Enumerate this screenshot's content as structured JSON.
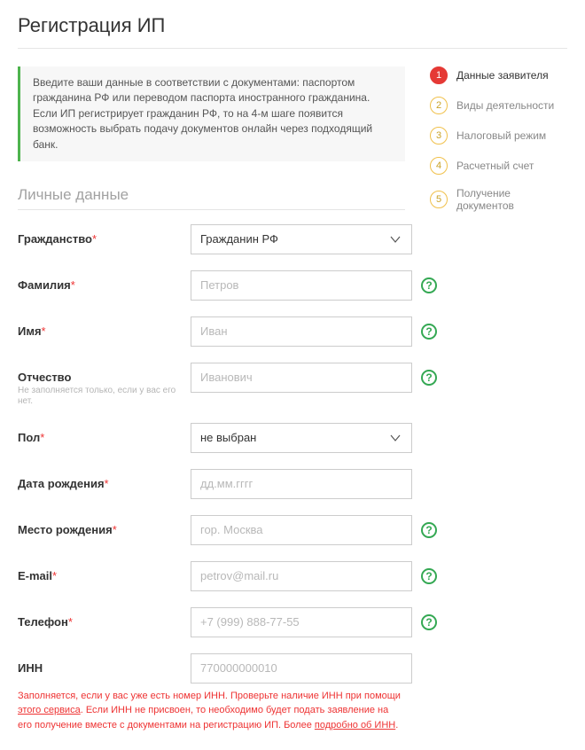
{
  "page_title": "Регистрация ИП",
  "info_notice": "Введите ваши данные в соответствии с документами: паспортом гражданина РФ или переводом паспорта иностранного гражданина.\nЕсли ИП регистрирует гражданин РФ, то на 4-м шаге появится возможность выбрать подачу документов онлайн через подходящий банк.",
  "section_title": "Личные данные",
  "fields": {
    "citizenship": {
      "label": "Гражданство",
      "required": true,
      "value": "Гражданин РФ"
    },
    "lastname": {
      "label": "Фамилия",
      "required": true,
      "placeholder": "Петров"
    },
    "firstname": {
      "label": "Имя",
      "required": true,
      "placeholder": "Иван"
    },
    "patronymic": {
      "label": "Отчество",
      "required": false,
      "placeholder": "Иванович",
      "hint": "Не заполняется только, если у вас его нет."
    },
    "gender": {
      "label": "Пол",
      "required": true,
      "value": "не выбран"
    },
    "birthdate": {
      "label": "Дата рождения",
      "required": true,
      "placeholder": "дд.мм.гггг"
    },
    "birthplace": {
      "label": "Место рождения",
      "required": true,
      "placeholder": "гор. Москва"
    },
    "email": {
      "label": "E-mail",
      "required": true,
      "placeholder": "petrov@mail.ru"
    },
    "phone": {
      "label": "Телефон",
      "required": true,
      "placeholder": "+7 (999) 888-77-55"
    },
    "inn": {
      "label": "ИНН",
      "required": false,
      "placeholder": "770000000010"
    }
  },
  "inn_note": {
    "part1": "Заполняется, если у вас уже есть номер ИНН. Проверьте наличие ИНН при помощи ",
    "link1": "этого сервиса",
    "part2": ". Если ИНН не присвоен, то необходимо будет подать заявление на его получение вместе с документами на регистрацию ИП. Более ",
    "link2": "подробно об ИНН",
    "part3": "."
  },
  "steps": [
    {
      "num": "1",
      "label": "Данные заявителя",
      "active": true
    },
    {
      "num": "2",
      "label": "Виды деятельности",
      "active": false
    },
    {
      "num": "3",
      "label": "Налоговый режим",
      "active": false
    },
    {
      "num": "4",
      "label": "Расчетный счет",
      "active": false
    },
    {
      "num": "5",
      "label": "Получение документов",
      "active": false
    }
  ]
}
